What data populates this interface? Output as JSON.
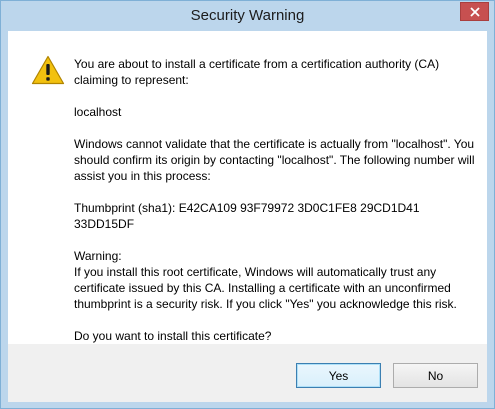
{
  "dialog": {
    "title": "Security Warning",
    "close_icon": "close-icon",
    "warning_icon": "warning-triangle-icon",
    "paragraphs": {
      "intro": "You are about to install a certificate from a certification authority (CA) claiming to represent:",
      "host": "localhost",
      "validate": "Windows cannot validate that the certificate is actually from \"localhost\". You should confirm its origin by contacting \"localhost\". The following number will assist you in this process:",
      "thumbprint": "Thumbprint (sha1): E42CA109 93F79972 3D0C1FE8 29CD1D41 33DD15DF",
      "warning_heading": "Warning:",
      "warning_body": "If you install this root certificate, Windows will automatically trust any certificate issued by this CA. Installing a certificate with an unconfirmed thumbprint is a security risk. If you click \"Yes\" you acknowledge this risk.",
      "question": "Do you want to install this certificate?"
    },
    "buttons": {
      "yes": "Yes",
      "no": "No"
    },
    "colors": {
      "titlebar": "#bcd6ec",
      "close": "#c75050",
      "warning": "#f2c10f"
    }
  }
}
